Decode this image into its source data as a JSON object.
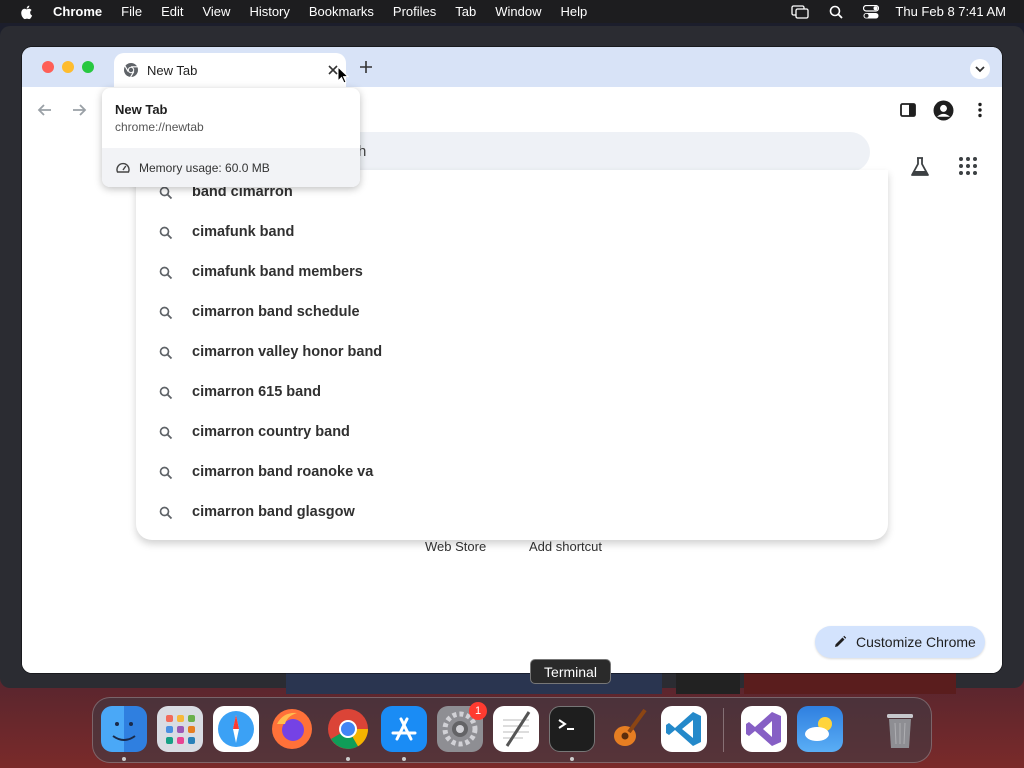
{
  "menubar": {
    "app_name": "Chrome",
    "items": [
      "File",
      "Edit",
      "View",
      "History",
      "Bookmarks",
      "Profiles",
      "Tab",
      "Window",
      "Help"
    ],
    "clock": "Thu Feb 8  7:41 AM"
  },
  "tab": {
    "title": "New Tab"
  },
  "hover_card": {
    "title": "New Tab",
    "url": "chrome://newtab",
    "memory": "Memory usage: 60.0 MB"
  },
  "omnibox": {
    "partial_text": "h"
  },
  "suggestions": [
    "band cimarron",
    "cimafunk band",
    "cimafunk band members",
    "cimarron band schedule",
    "cimarron valley honor band",
    "cimarron 615 band",
    "cimarron country band",
    "cimarron band roanoke va",
    "cimarron band glasgow"
  ],
  "shortcuts": {
    "web_store": "Web Store",
    "add_shortcut": "Add shortcut"
  },
  "customize_label": "Customize Chrome",
  "tooltip": "Terminal",
  "dock": {
    "apps": [
      "finder-icon",
      "launchpad-icon",
      "safari-icon",
      "firefox-icon",
      "chrome-icon",
      "app-store-icon",
      "system-settings-icon",
      "textedit-icon",
      "terminal-icon",
      "garageband-icon",
      "vscode-icon",
      "visual-studio-icon",
      "weather-icon",
      "trash-icon"
    ],
    "settings_badge": "1"
  },
  "colors": {
    "tabstrip": "#d8e3f7",
    "customize_bg": "#d3e3fd",
    "menubar": "#1d1d1f"
  }
}
